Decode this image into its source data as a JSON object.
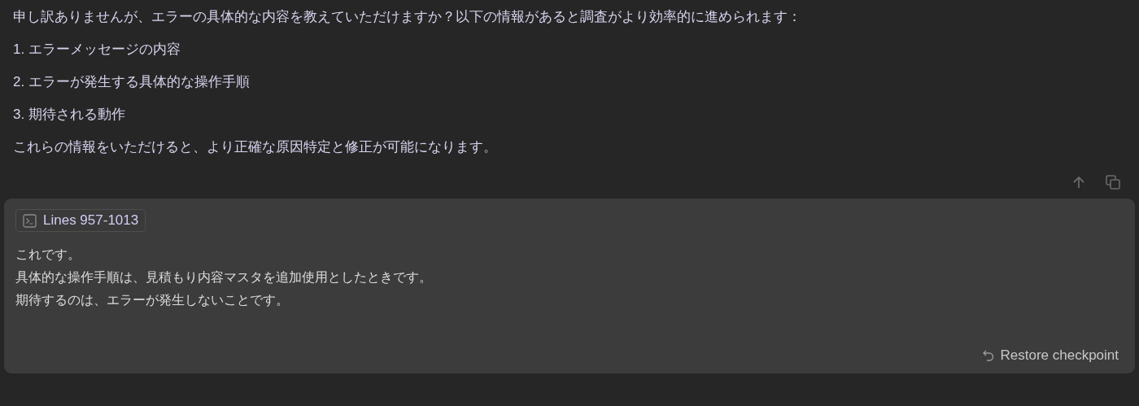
{
  "assistant_message": {
    "intro": "申し訳ありませんが、エラーの具体的な内容を教えていただけますか？以下の情報があると調査がより効率的に進められます：",
    "list": [
      "1. エラーメッセージの内容",
      "2. エラーが発生する具体的な操作手順",
      "3. 期待される動作"
    ],
    "closing": "これらの情報をいただけると、より正確な原因特定と修正が可能になります。"
  },
  "user_message": {
    "context_chip": "Lines 957-1013",
    "lines": [
      "これです。",
      "具体的な操作手順は、見積もり内容マスタを追加使用としたときです。",
      "期待するのは、エラーが発生しないことです。"
    ],
    "restore_button": "Restore checkpoint"
  }
}
